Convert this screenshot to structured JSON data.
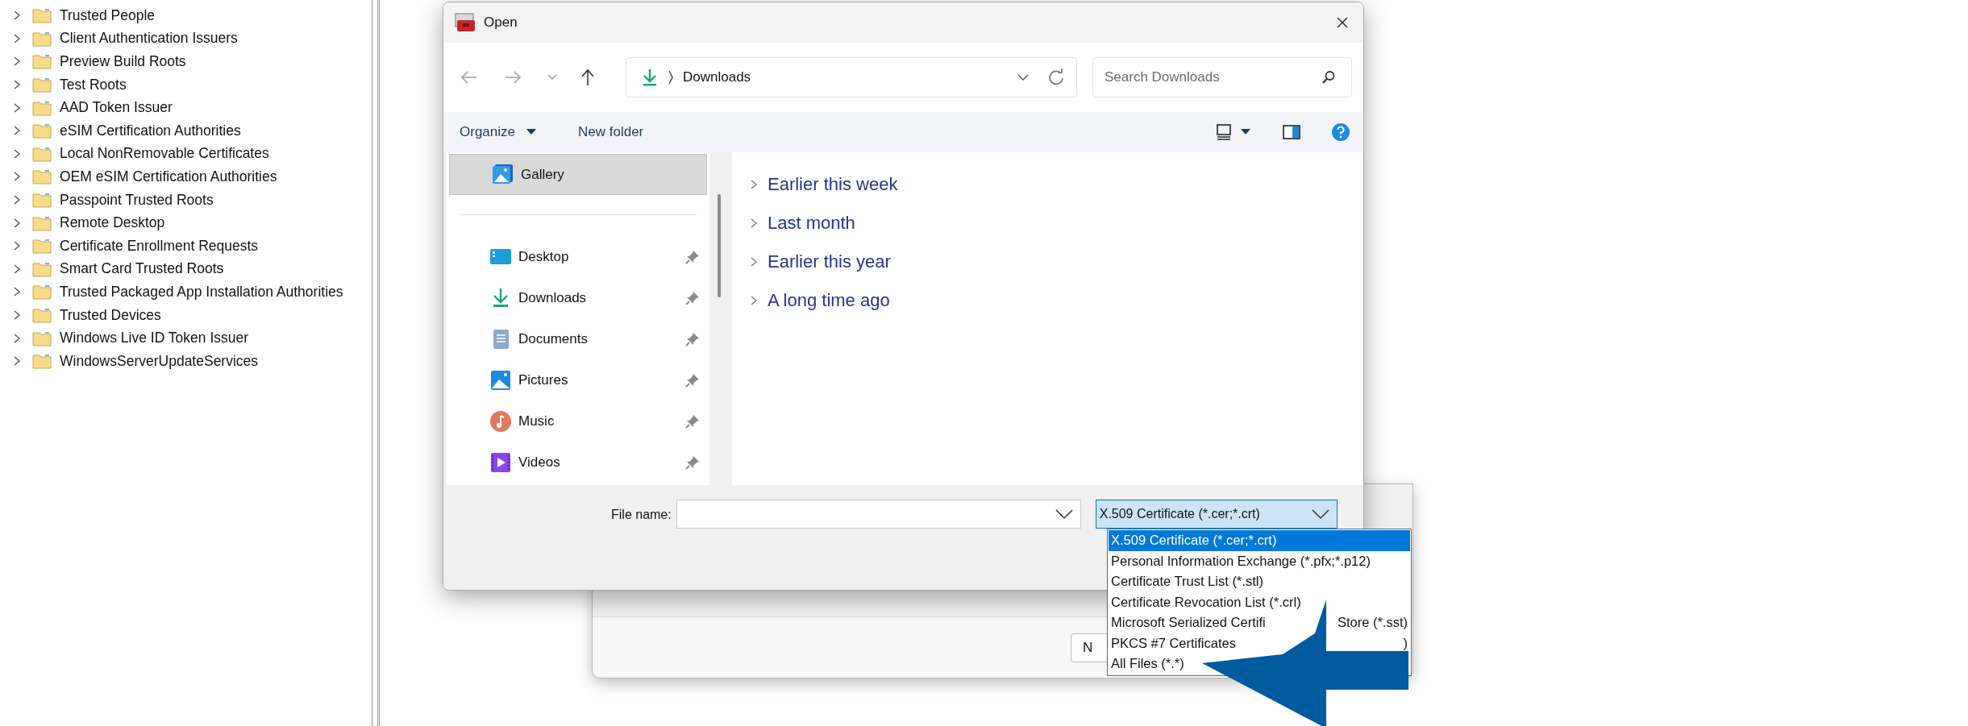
{
  "tree": {
    "items": [
      {
        "label": "Trusted People",
        "expanded": false
      },
      {
        "label": "Client Authentication Issuers",
        "expanded": false
      },
      {
        "label": "Preview Build Roots",
        "expanded": false
      },
      {
        "label": "Test Roots",
        "expanded": false
      },
      {
        "label": "AAD Token Issuer",
        "expanded": false
      },
      {
        "label": "eSIM Certification Authorities",
        "expanded": false
      },
      {
        "label": "Local NonRemovable Certificates",
        "expanded": false
      },
      {
        "label": "OEM eSIM Certification Authorities",
        "expanded": false
      },
      {
        "label": "Passpoint Trusted Roots",
        "expanded": false
      },
      {
        "label": "Remote Desktop",
        "expanded": false
      },
      {
        "label": "Certificate Enrollment Requests",
        "expanded": false
      },
      {
        "label": "Smart Card Trusted Roots",
        "expanded": false
      },
      {
        "label": "Trusted Packaged App Installation Authorities",
        "expanded": false
      },
      {
        "label": "Trusted Devices",
        "expanded": false
      },
      {
        "label": "Windows Live ID Token Issuer",
        "expanded": false
      },
      {
        "label": "WindowsServerUpdateServices",
        "expanded": false
      }
    ]
  },
  "background_window": {
    "button": "N"
  },
  "dialog": {
    "title": "Open",
    "address": {
      "location": "Downloads"
    },
    "search": {
      "placeholder": "Search Downloads"
    },
    "toolbar": {
      "organize": "Organize",
      "new_folder": "New folder"
    },
    "nav": [
      {
        "label": "Gallery",
        "kind": "gallery",
        "selected": true,
        "pinned": false
      },
      {
        "label": "Desktop",
        "kind": "desktop",
        "selected": false,
        "pinned": true
      },
      {
        "label": "Downloads",
        "kind": "downloads",
        "selected": false,
        "pinned": true
      },
      {
        "label": "Documents",
        "kind": "documents",
        "selected": false,
        "pinned": true
      },
      {
        "label": "Pictures",
        "kind": "pictures",
        "selected": false,
        "pinned": true
      },
      {
        "label": "Music",
        "kind": "music",
        "selected": false,
        "pinned": true
      },
      {
        "label": "Videos",
        "kind": "videos",
        "selected": false,
        "pinned": true
      }
    ],
    "groups": [
      {
        "label": "Earlier this week",
        "expanded": false
      },
      {
        "label": "Last month",
        "expanded": false
      },
      {
        "label": "Earlier this year",
        "expanded": false
      },
      {
        "label": "A long time ago",
        "expanded": false
      }
    ],
    "file_name": {
      "label": "File name:"
    },
    "file_type": {
      "value": "X.509 Certificate (*.cer;*.crt)",
      "open": true,
      "options": [
        {
          "label": "X.509 Certificate (*.cer;*.crt)",
          "selected": true
        },
        {
          "label": "Personal Information Exchange (*.pfx;*.p12)",
          "selected": false
        },
        {
          "label": "Certificate Trust List (*.stl)",
          "selected": false
        },
        {
          "label": "Certificate Revocation List (*.crl)",
          "selected": false
        },
        {
          "label": "Microsoft Serialized Certifi",
          "tail": "Store (*.sst)",
          "selected": false
        },
        {
          "label": "PKCS #7 Certificates",
          "tail": ")",
          "selected": false
        },
        {
          "label": "All Files (*.*)",
          "selected": false
        }
      ]
    }
  }
}
